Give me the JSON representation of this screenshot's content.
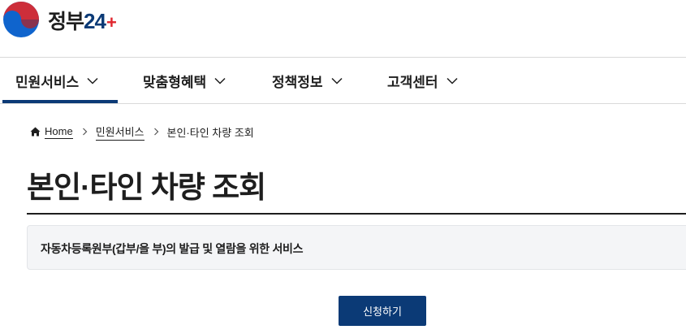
{
  "header": {
    "logo_text": "정부",
    "logo_number": "24",
    "logo_plus": "+"
  },
  "gnb": {
    "items": [
      {
        "label": "민원서비스",
        "active": true
      },
      {
        "label": "맞춤형혜택",
        "active": false
      },
      {
        "label": "정책정보",
        "active": false
      },
      {
        "label": "고객센터",
        "active": false
      }
    ]
  },
  "breadcrumb": {
    "home": "Home",
    "level1": "민원서비스",
    "current": "본인·타인 차량 조회"
  },
  "page": {
    "title": "본인·타인 차량 조회",
    "description": "자동차등록원부(갑부/을 부)의 발급 및 열람을 위한 서비스"
  },
  "actions": {
    "apply_label": "신청하기"
  },
  "colors": {
    "primary": "#0b3a76",
    "emblem_red": "#cd2e3a",
    "emblem_blue": "#0f64cd",
    "desc_background": "#f4f5f7"
  },
  "icons": {
    "emblem": "taegeuk-emblem-icon",
    "home": "home-icon",
    "dropdown": "chevron-down-icon",
    "separator": "chevron-right-icon"
  }
}
